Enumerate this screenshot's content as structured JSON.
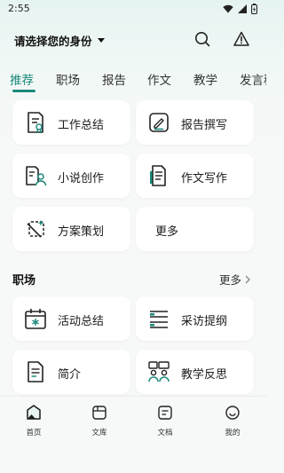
{
  "status": {
    "time": "2:55"
  },
  "header": {
    "identity_label": "请选择您的身份"
  },
  "tabs": [
    "推荐",
    "职场",
    "报告",
    "作文",
    "教学",
    "发言稿"
  ],
  "featured": [
    {
      "label": "工作总结",
      "icon": "work-summary-icon"
    },
    {
      "label": "报告撰写",
      "icon": "report-writing-icon"
    },
    {
      "label": "小说创作",
      "icon": "novel-writing-icon"
    },
    {
      "label": "作文写作",
      "icon": "essay-writing-icon"
    },
    {
      "label": "方案策划",
      "icon": "plan-icon"
    },
    {
      "label": "更多"
    }
  ],
  "workplace": {
    "title": "职场",
    "more": "更多",
    "items": [
      {
        "label": "活动总结",
        "icon": "calendar-icon"
      },
      {
        "label": "采访提纲",
        "icon": "list-icon"
      },
      {
        "label": "简介",
        "icon": "document-icon"
      },
      {
        "label": "教学反思",
        "icon": "discussion-icon"
      }
    ]
  },
  "nav": [
    {
      "label": "首页",
      "icon": "home-icon"
    },
    {
      "label": "文库",
      "icon": "library-icon"
    },
    {
      "label": "文档",
      "icon": "document-icon"
    },
    {
      "label": "我的",
      "icon": "profile-icon"
    }
  ],
  "colors": {
    "accent": "#1a8a7a",
    "background": "#f7f8f8",
    "card": "#ffffff"
  }
}
